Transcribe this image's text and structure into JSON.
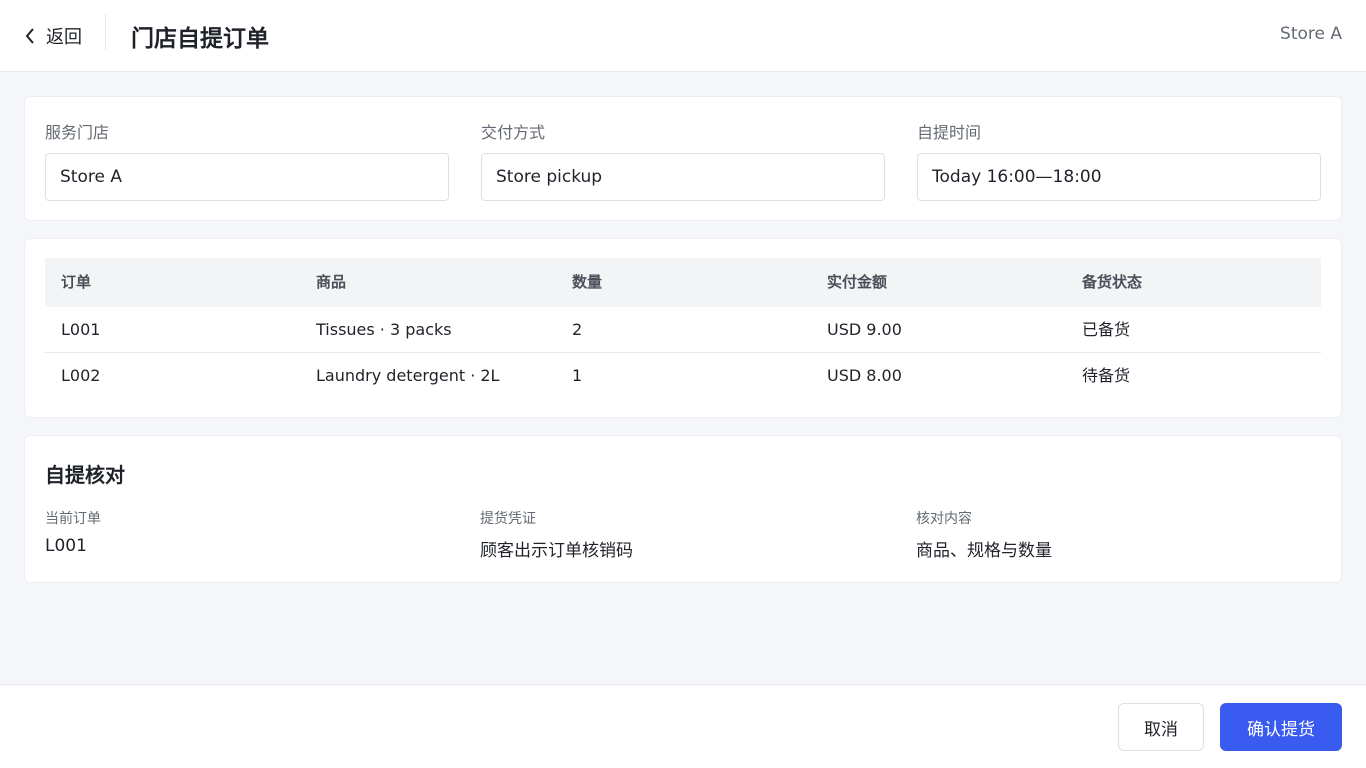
{
  "header": {
    "back_label": "返回",
    "title": "门店自提订单",
    "store": "Store A"
  },
  "fields": {
    "store": {
      "label": "服务门店",
      "value": "Store A"
    },
    "delivery": {
      "label": "交付方式",
      "value": "Store pickup"
    },
    "pickup_time": {
      "label": "自提时间",
      "value": "Today 16:00—18:00"
    }
  },
  "table": {
    "columns": [
      "订单",
      "商品",
      "数量",
      "实付金额",
      "备货状态"
    ],
    "rows": [
      [
        "L001",
        "Tissues · 3 packs",
        "2",
        "USD 9.00",
        "已备货"
      ],
      [
        "L002",
        "Laundry detergent · 2L",
        "1",
        "USD 8.00",
        "待备货"
      ]
    ]
  },
  "verify": {
    "title": "自提核对",
    "items": [
      {
        "label": "当前订单",
        "value": "L001"
      },
      {
        "label": "提货凭证",
        "value": "顾客出示订单核销码"
      },
      {
        "label": "核对内容",
        "value": "商品、规格与数量"
      }
    ]
  },
  "footer": {
    "cancel_label": "取消",
    "confirm_label": "确认提货"
  },
  "colors": {
    "primary": "#3a5bef",
    "background": "#f4f6f9"
  }
}
